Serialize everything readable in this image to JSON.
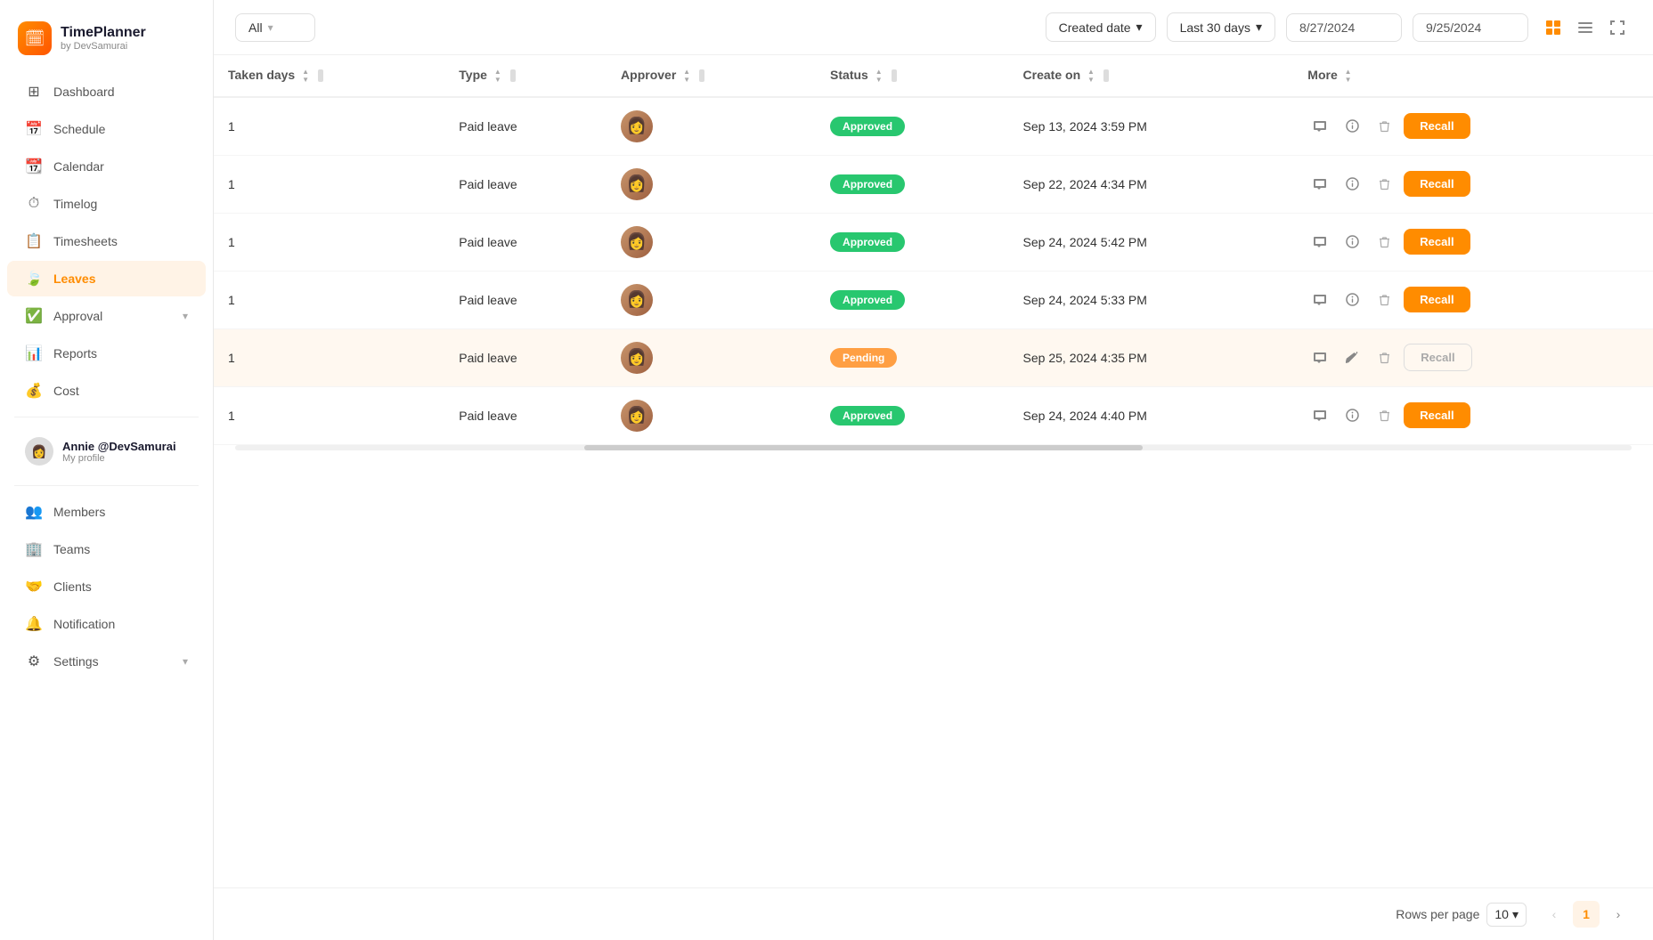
{
  "app": {
    "name": "TimePlanner",
    "subtitle": "by DevSamurai",
    "logo_emoji": "🗓"
  },
  "sidebar": {
    "nav_items": [
      {
        "id": "dashboard",
        "label": "Dashboard",
        "icon": "⊞",
        "active": false
      },
      {
        "id": "schedule",
        "label": "Schedule",
        "icon": "📅",
        "active": false
      },
      {
        "id": "calendar",
        "label": "Calendar",
        "icon": "📆",
        "active": false
      },
      {
        "id": "timelog",
        "label": "Timelog",
        "icon": "⏱",
        "active": false
      },
      {
        "id": "timesheets",
        "label": "Timesheets",
        "icon": "📋",
        "active": false
      },
      {
        "id": "leaves",
        "label": "Leaves",
        "icon": "🍃",
        "active": true
      },
      {
        "id": "approval",
        "label": "Approval",
        "icon": "✅",
        "active": false,
        "has_chevron": true
      },
      {
        "id": "reports",
        "label": "Reports",
        "icon": "📊",
        "active": false
      },
      {
        "id": "cost",
        "label": "Cost",
        "icon": "💰",
        "active": false
      }
    ],
    "profile": {
      "name": "Annie @DevSamurai",
      "role": "My profile"
    },
    "bottom_items": [
      {
        "id": "members",
        "label": "Members",
        "icon": "👥"
      },
      {
        "id": "teams",
        "label": "Teams",
        "icon": "🏢"
      },
      {
        "id": "clients",
        "label": "Clients",
        "icon": "🤝"
      },
      {
        "id": "notification",
        "label": "Notification",
        "icon": "🔔"
      },
      {
        "id": "settings",
        "label": "Settings",
        "icon": "⚙",
        "has_chevron": true
      }
    ]
  },
  "topbar": {
    "filter_label": "All",
    "filter_placeholder": "All",
    "date_filter_label": "Created date",
    "date_range_label": "Last 30 days",
    "date_start": "8/27/2024",
    "date_end": "9/25/2024"
  },
  "table": {
    "columns": [
      {
        "id": "taken_days",
        "label": "Taken days"
      },
      {
        "id": "type",
        "label": "Type"
      },
      {
        "id": "approver",
        "label": "Approver"
      },
      {
        "id": "status",
        "label": "Status"
      },
      {
        "id": "create_on",
        "label": "Create on"
      },
      {
        "id": "more",
        "label": "More"
      }
    ],
    "rows": [
      {
        "taken_days": "1",
        "type": "Paid leave",
        "status": "Approved",
        "status_type": "approved",
        "create_on": "Sep 13, 2024 3:59 PM",
        "highlighted": false
      },
      {
        "taken_days": "1",
        "type": "Paid leave",
        "status": "Approved",
        "status_type": "approved",
        "create_on": "Sep 22, 2024 4:34 PM",
        "highlighted": false
      },
      {
        "taken_days": "1",
        "type": "Paid leave",
        "status": "Approved",
        "status_type": "approved",
        "create_on": "Sep 24, 2024 5:42 PM",
        "highlighted": false
      },
      {
        "taken_days": "1",
        "type": "Paid leave",
        "status": "Approved",
        "status_type": "approved",
        "create_on": "Sep 24, 2024 5:33 PM",
        "highlighted": false
      },
      {
        "taken_days": "1",
        "type": "Paid leave",
        "status": "Pending",
        "status_type": "pending",
        "create_on": "Sep 25, 2024 4:35 PM",
        "highlighted": true
      },
      {
        "taken_days": "1",
        "type": "Paid leave",
        "status": "Approved",
        "status_type": "approved",
        "create_on": "Sep 24, 2024 4:40 PM",
        "highlighted": false
      }
    ]
  },
  "footer": {
    "rows_per_page_label": "Rows per page",
    "rows_per_page_value": "10",
    "current_page": "1",
    "prev_label": "‹",
    "next_label": "›"
  }
}
